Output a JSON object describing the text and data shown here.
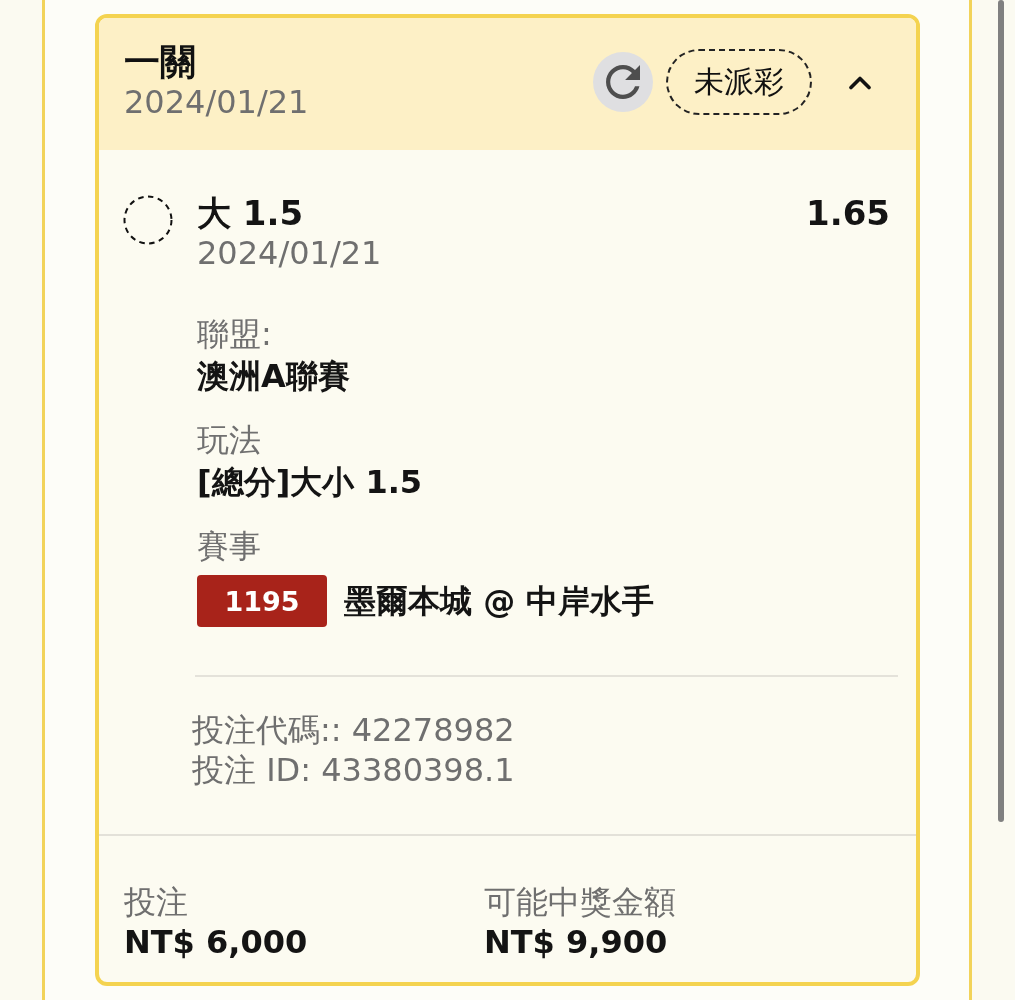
{
  "bet_card": {
    "title": "一關",
    "date": "2024/01/21",
    "status": "未派彩",
    "expanded": true
  },
  "selection": {
    "pick": "大 1.5",
    "date": "2024/01/21",
    "odds": "1.65"
  },
  "details": [
    {
      "kind": "text",
      "label": "聯盟:",
      "value": "澳洲A聯賽"
    },
    {
      "kind": "text",
      "label": "玩法",
      "value": "[總分]大小 1.5"
    },
    {
      "kind": "match",
      "label": "賽事",
      "match_number": "1195",
      "value": "墨爾本城 @ 中岸水手"
    }
  ],
  "references": [
    "投注代碼:: 42278982",
    "投注 ID: 43380398.1"
  ],
  "totals": [
    {
      "label": "投注",
      "value": "NT$ 6,000"
    },
    {
      "label": "可能中獎金額",
      "value": "NT$ 9,900"
    }
  ]
}
